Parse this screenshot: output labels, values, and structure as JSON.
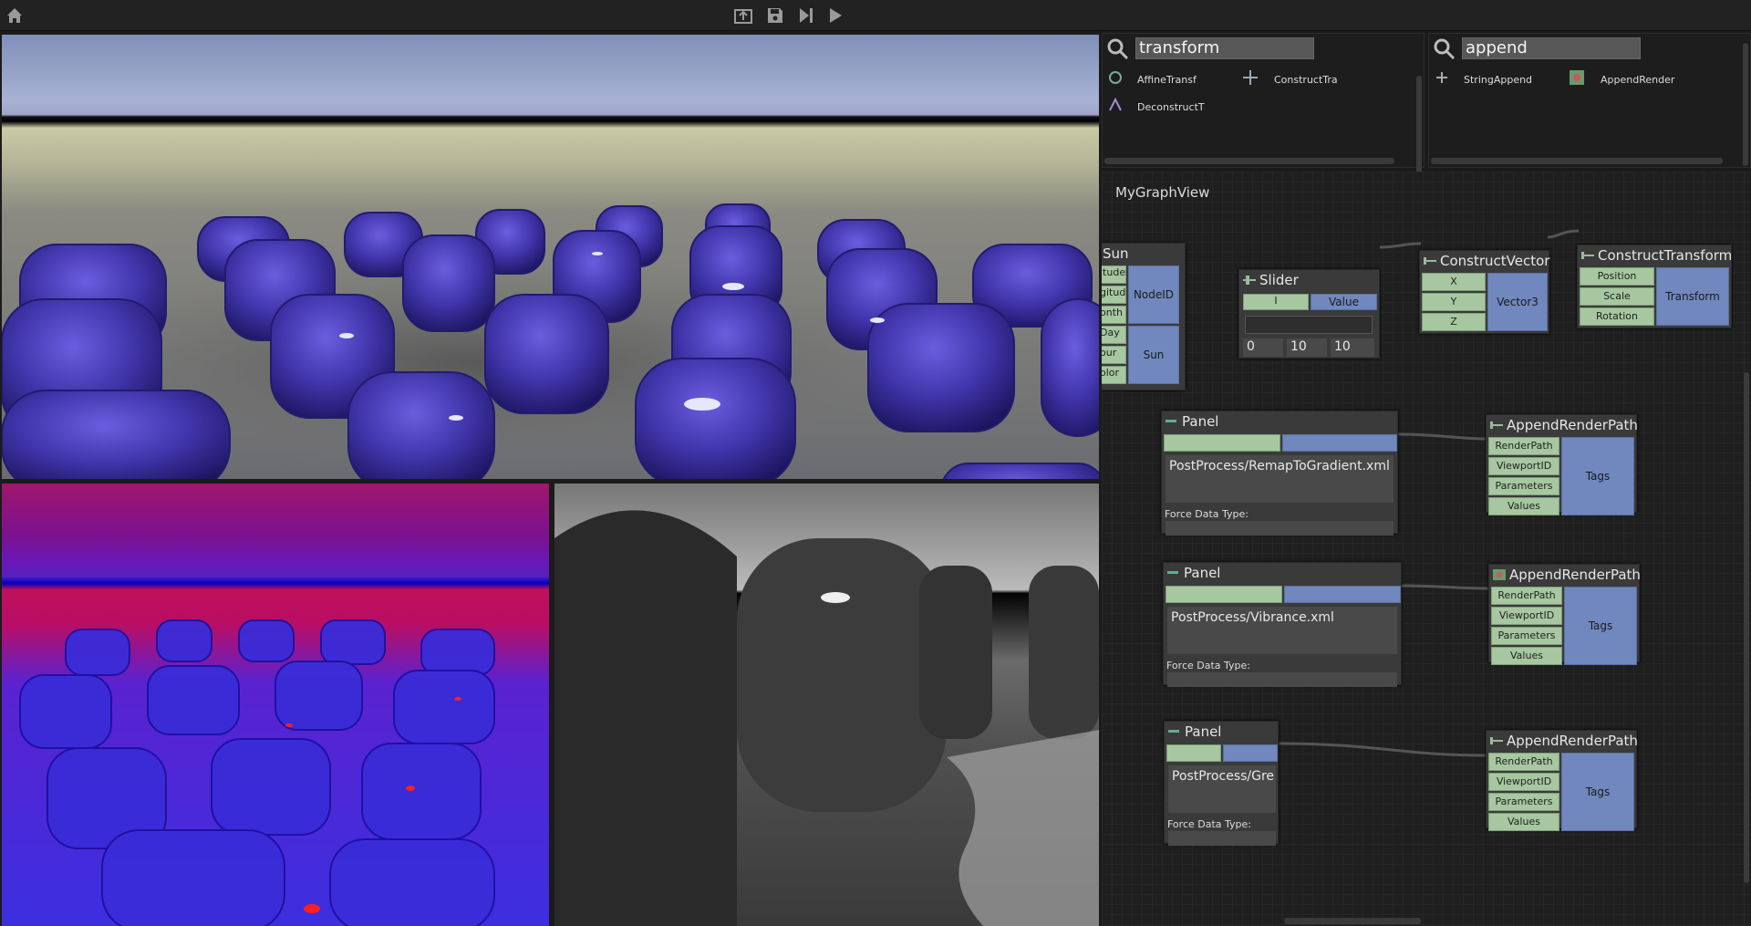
{
  "toolbar": {
    "home": "home-icon",
    "export": "export-icon",
    "save": "save-icon",
    "step": "step-forward-icon",
    "play": "play-icon"
  },
  "search_left": {
    "query": "transform",
    "results": [
      "AffineTransf",
      "ConstructTra",
      "DeconstructT"
    ]
  },
  "search_right": {
    "query": "append",
    "results": [
      "StringAppend",
      "AppendRender"
    ]
  },
  "graph": {
    "title": "MyGraphView",
    "sun": {
      "title": "Sun",
      "inputs": [
        "itude",
        "gitude",
        "onth",
        "Day",
        "our",
        "olor"
      ],
      "outputs": [
        "NodeID",
        "Sun"
      ]
    },
    "slider": {
      "title": "Slider",
      "input": "I",
      "output": "Value",
      "min": "0",
      "value": "10",
      "max": "10"
    },
    "construct_vector": {
      "title": "ConstructVector",
      "inputs": [
        "X",
        "Y",
        "Z"
      ],
      "output": "Vector3"
    },
    "construct_transform": {
      "title": "ConstructTransform",
      "inputs": [
        "Position",
        "Scale",
        "Rotation"
      ],
      "output": "Transform"
    },
    "panels": [
      {
        "title": "Panel",
        "text": "PostProcess/RemapToGradient.xml",
        "force_label": "Force Data Type:"
      },
      {
        "title": "Panel",
        "text": "PostProcess/Vibrance.xml",
        "force_label": "Force Data Type:"
      },
      {
        "title": "Panel",
        "text": "PostProcess/Gre",
        "force_label": "Force Data Type:"
      }
    ],
    "append_nodes": [
      {
        "title": "AppendRenderPath",
        "inputs": [
          "RenderPath",
          "ViewportID",
          "Parameters",
          "Values"
        ],
        "output": "Tags"
      },
      {
        "title": "AppendRenderPath",
        "inputs": [
          "RenderPath",
          "ViewportID",
          "Parameters",
          "Values"
        ],
        "output": "Tags"
      },
      {
        "title": "AppendRenderPath",
        "inputs": [
          "RenderPath",
          "ViewportID",
          "Parameters",
          "Values"
        ],
        "output": "Tags"
      }
    ]
  },
  "colors": {
    "input_port": "#a6c7a0",
    "output_port": "#7088be",
    "node_body": "#3a3a3a",
    "viewport_main_ground": "#c8cba4",
    "cube_color": "#4a3fb8"
  }
}
